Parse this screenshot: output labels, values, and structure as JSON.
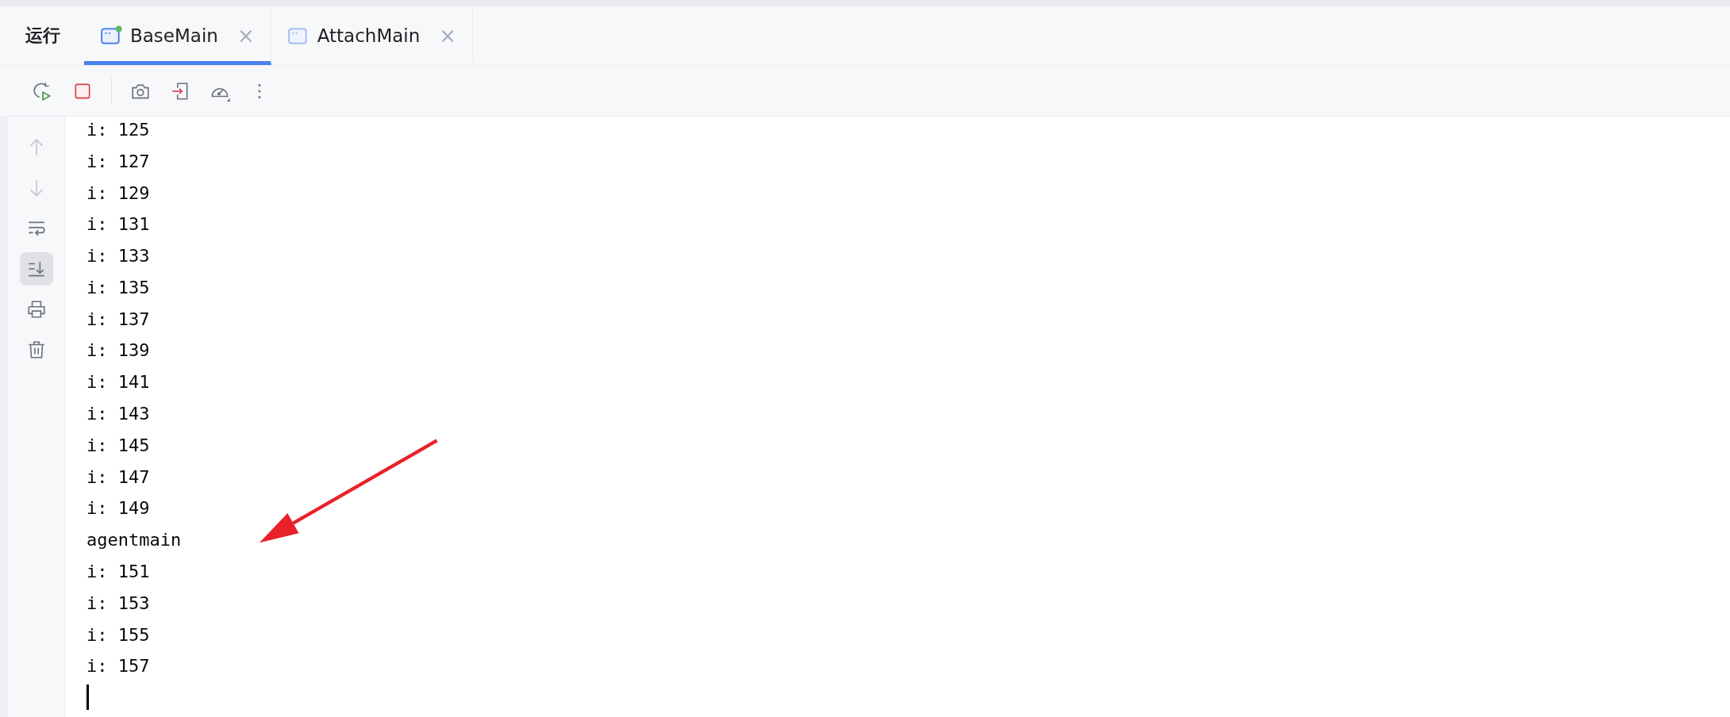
{
  "panel": {
    "title": "运行"
  },
  "tabs": [
    {
      "label": "BaseMain",
      "selected": true,
      "running": true,
      "close": "×"
    },
    {
      "label": "AttachMain",
      "selected": false,
      "running": false,
      "close": "×"
    }
  ],
  "toolbar": [
    {
      "kind": "rerun"
    },
    {
      "kind": "stop"
    },
    {
      "kind": "separator"
    },
    {
      "kind": "camera"
    },
    {
      "kind": "exit"
    },
    {
      "kind": "gauge"
    },
    {
      "kind": "more"
    }
  ],
  "side_tools": [
    {
      "kind": "up",
      "disabled": true,
      "selected": false
    },
    {
      "kind": "down",
      "disabled": true,
      "selected": false
    },
    {
      "kind": "wrap",
      "disabled": false,
      "selected": false
    },
    {
      "kind": "scroll_end",
      "disabled": false,
      "selected": true
    },
    {
      "kind": "print",
      "disabled": false,
      "selected": false
    },
    {
      "kind": "trash",
      "disabled": false,
      "selected": false
    }
  ],
  "console": {
    "lines": [
      "i: 125",
      "i: 127",
      "i: 129",
      "i: 131",
      "i: 133",
      "i: 135",
      "i: 137",
      "i: 139",
      "i: 141",
      "i: 143",
      "i: 145",
      "i: 147",
      "i: 149",
      "agentmain",
      "i: 151",
      "i: 153",
      "i: 155",
      "i: 157"
    ]
  }
}
